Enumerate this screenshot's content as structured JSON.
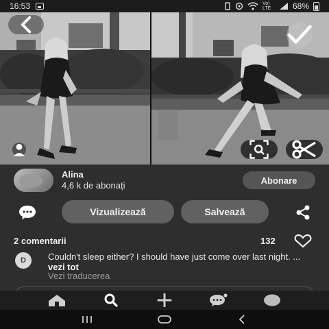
{
  "status_bar": {
    "time": "16:53",
    "network_label": "Vo) LTE",
    "battery_percent": "68%",
    "icons": [
      "image-icon",
      "vibrate-icon",
      "location-icon",
      "wifi-icon",
      "signal-icon",
      "battery-icon"
    ]
  },
  "pin": {
    "photo_left_desc_icon": "profile-icon",
    "buttons": [
      "back-arrow-icon",
      "checkmark-icon",
      "visual-search-icon",
      "scissors-icon"
    ]
  },
  "creator": {
    "name": "Alina",
    "followers": "4,6 k de abonați",
    "follow_label": "Abonare"
  },
  "actions": {
    "view_label": "Vizualizează",
    "save_label": "Salvează"
  },
  "comments": {
    "count_label": "2 comentarii",
    "like_count": "132",
    "first": {
      "avatar_letter": "D",
      "text": "Couldn't sleep either? I should have just come over last night. ... ",
      "more": "vezi tot",
      "translate": "Vezi traducerea"
    }
  },
  "bottom_nav": {
    "items": [
      "home-icon",
      "search-icon",
      "plus-icon",
      "messages-icon",
      "profile-icon"
    ]
  },
  "colors": {
    "background": "#2e2e2e",
    "button": "#616161",
    "nav_bar": "#1e1e1e"
  }
}
